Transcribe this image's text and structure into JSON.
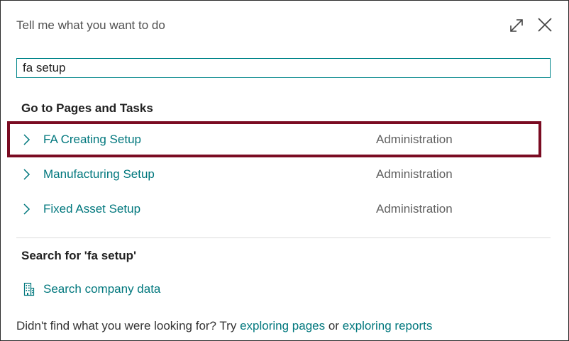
{
  "dialog": {
    "title": "Tell me what you want to do",
    "expand_icon": "expand-diagonal-icon",
    "close_icon": "close-x-icon"
  },
  "search": {
    "value": "fa setup"
  },
  "pages_section": {
    "heading": "Go to Pages and Tasks",
    "results": [
      {
        "name": "FA Creating Setup",
        "category": "Administration",
        "highlighted": true
      },
      {
        "name": "Manufacturing Setup",
        "category": "Administration",
        "highlighted": false
      },
      {
        "name": "Fixed Asset Setup",
        "category": "Administration",
        "highlighted": false
      }
    ]
  },
  "search_section": {
    "heading": "Search for 'fa setup'",
    "company_search_label": "Search company data",
    "company_search_icon": "building-icon"
  },
  "footer": {
    "prefix": "Didn't find what you were looking for? Try",
    "link_pages": "exploring pages",
    "conjunction": "or",
    "link_reports": "exploring reports"
  },
  "colors": {
    "link": "#00777d",
    "input_border": "#00858a",
    "highlight_border": "#7a0b22",
    "text": "#212121",
    "muted": "#616161"
  }
}
